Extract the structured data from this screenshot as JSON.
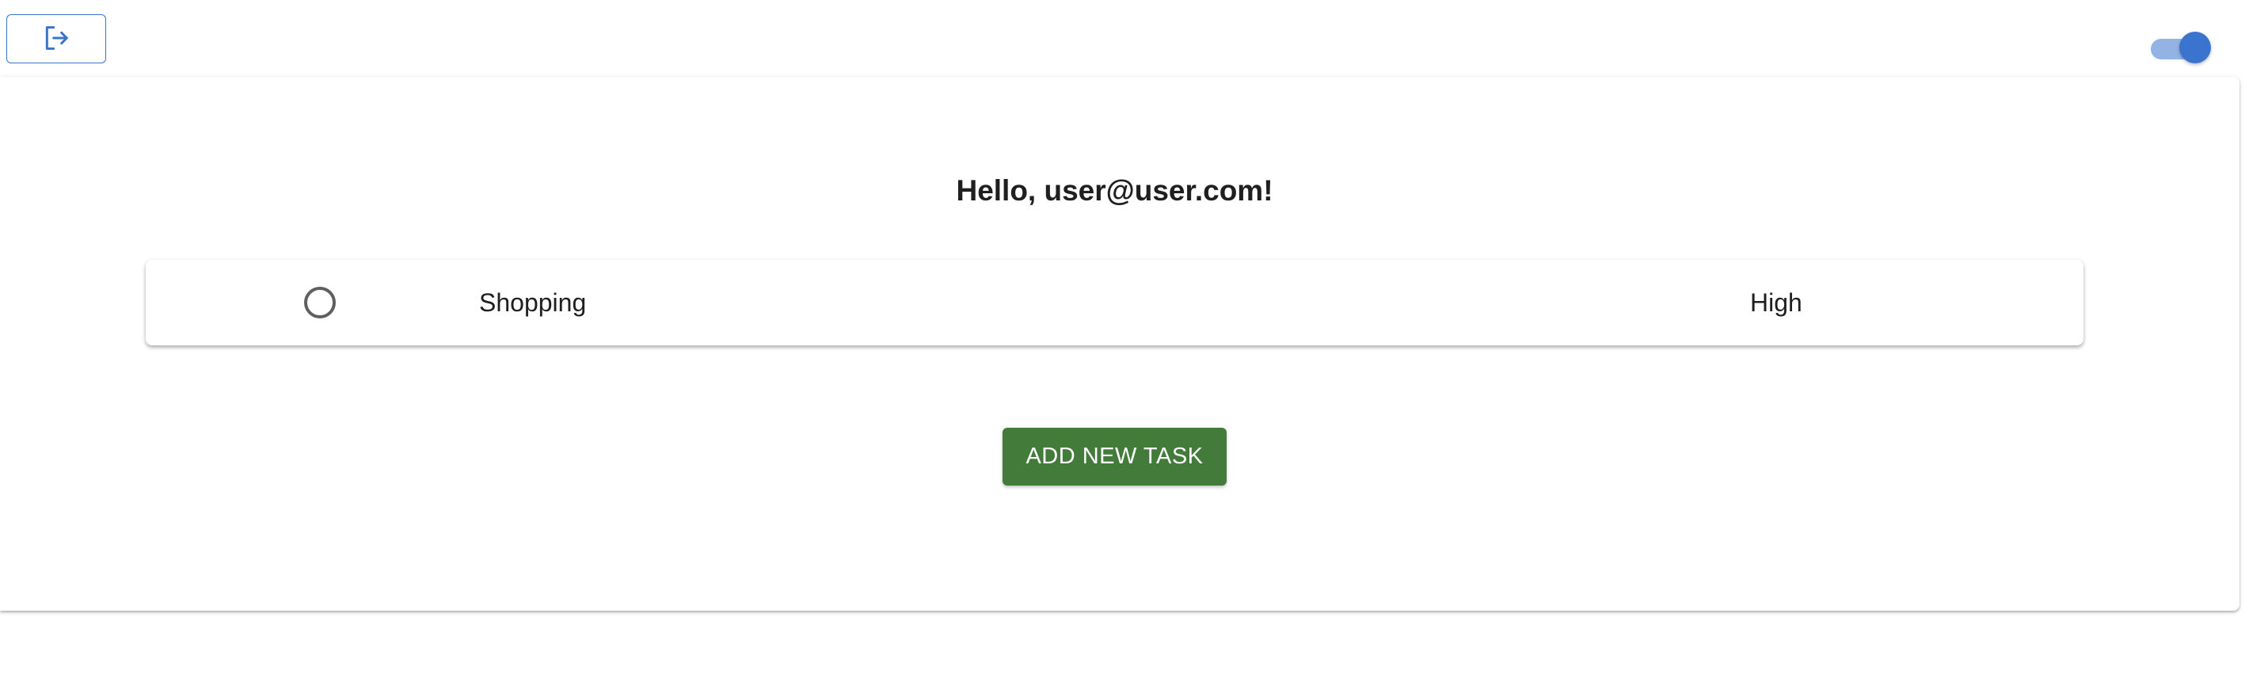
{
  "header": {
    "logout_icon": "logout-icon",
    "theme_toggle": {
      "checked": true
    }
  },
  "main": {
    "greeting": "Hello, user@user.com!",
    "tasks": [
      {
        "title": "Shopping",
        "priority": "High",
        "completed": false
      }
    ],
    "add_button_label": "ADD NEW TASK"
  },
  "colors": {
    "accent": "#3b74cf",
    "add_button": "#437c3a",
    "text": "#1f1f1f"
  }
}
